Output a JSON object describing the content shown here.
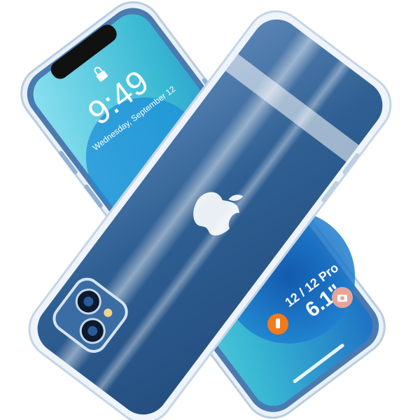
{
  "lockscreen": {
    "time": "9:49",
    "date": "Wednesday, September 12"
  },
  "badge": {
    "models": "12 / 12 Pro",
    "size": "6.1\""
  },
  "colors": {
    "background": "#ffffff",
    "phone_blue": "#2f5f93",
    "frame_blue": "#4a7ab0",
    "screen_teal": "#39b9d3",
    "wallpaper_blue": "#1d6fc4",
    "badge_orange": "#f07a1e",
    "badge_pink": "#e8a49a"
  },
  "icons": [
    "apple-logo-icon",
    "camera-icon",
    "flashlight-icon",
    "lock-icon"
  ]
}
